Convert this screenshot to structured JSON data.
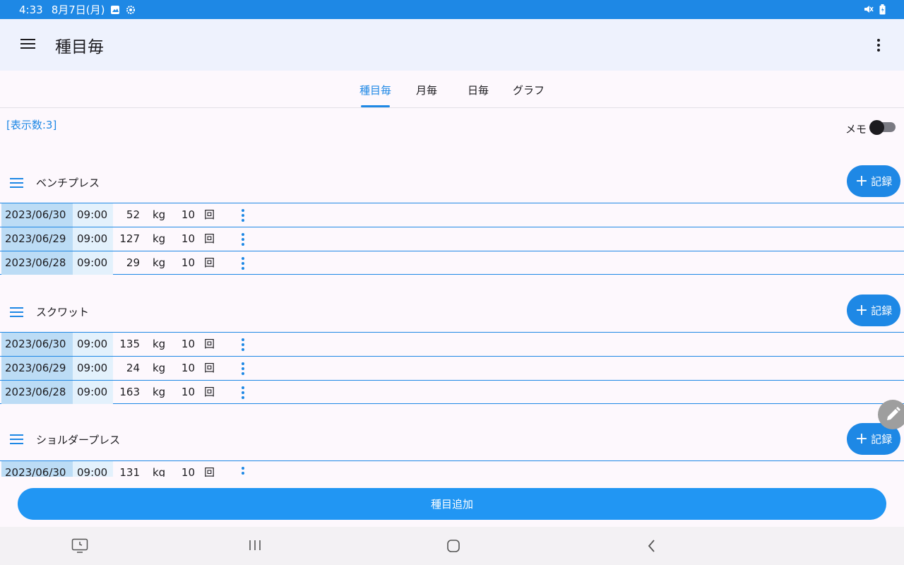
{
  "status": {
    "time": "4:33",
    "date": "8月7日(月)"
  },
  "appbar": {
    "title": "種目毎"
  },
  "tabs": [
    {
      "label": "種目毎",
      "active": true
    },
    {
      "label": "月毎",
      "active": false
    },
    {
      "label": "日毎",
      "active": false
    },
    {
      "label": "グラフ",
      "active": false
    }
  ],
  "display_count": "[表示数:3]",
  "memo_label": "メモ",
  "memo_toggle_on": false,
  "record_button_label": "記録",
  "weight_unit": "kg",
  "reps_unit": "回",
  "exercises": [
    {
      "name": "ベンチプレス",
      "rows": [
        {
          "date": "2023/06/30",
          "time": "09:00",
          "weight": "52",
          "reps": "10"
        },
        {
          "date": "2023/06/29",
          "time": "09:00",
          "weight": "127",
          "reps": "10"
        },
        {
          "date": "2023/06/28",
          "time": "09:00",
          "weight": "29",
          "reps": "10"
        }
      ]
    },
    {
      "name": "スクワット",
      "rows": [
        {
          "date": "2023/06/30",
          "time": "09:00",
          "weight": "135",
          "reps": "10"
        },
        {
          "date": "2023/06/29",
          "time": "09:00",
          "weight": "24",
          "reps": "10"
        },
        {
          "date": "2023/06/28",
          "time": "09:00",
          "weight": "163",
          "reps": "10"
        }
      ]
    },
    {
      "name": "ショルダープレス",
      "rows": [
        {
          "date": "2023/06/30",
          "time": "09:00",
          "weight": "131",
          "reps": "10"
        }
      ]
    }
  ],
  "add_exercise_label": "種目追加",
  "colors": {
    "accent": "#1e88e5",
    "date_cell": "#bcdcf5",
    "time_cell": "#e3f1fc"
  }
}
